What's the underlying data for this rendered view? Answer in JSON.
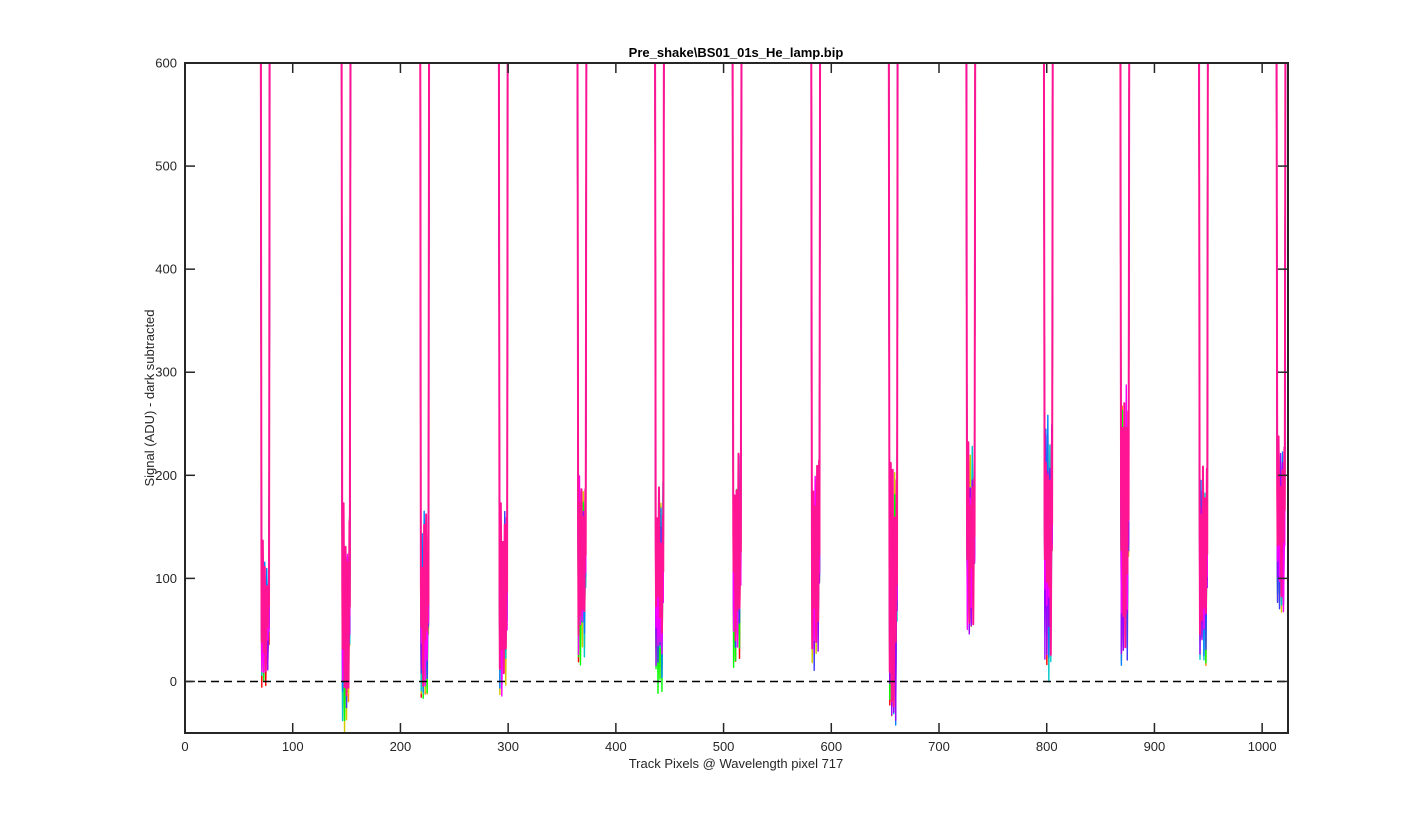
{
  "chart_data": {
    "type": "line",
    "title": "Pre_shake\\BS01_01s_He_lamp.bip",
    "xlabel": "Track Pixels @ Wavelength pixel 717",
    "ylabel": "Signal (ADU) - dark subtracted",
    "xlim": [
      0,
      1024
    ],
    "ylim": [
      -50,
      600
    ],
    "xticks": [
      0,
      100,
      200,
      300,
      400,
      500,
      600,
      700,
      800,
      900,
      1000
    ],
    "yticks": [
      0,
      100,
      200,
      300,
      400,
      500,
      600
    ],
    "grid": false,
    "legend": "none",
    "reference_line": {
      "y": 0,
      "style": "dashed",
      "color": "#000000"
    },
    "series_colors": [
      "#ff0000",
      "#ff8c00",
      "#d4c800",
      "#00ff00",
      "#00c8c8",
      "#0080ff",
      "#3c3cff",
      "#a000ff",
      "#ff00ff",
      "#ff1493"
    ],
    "track_pairs": [
      {
        "x1": 71,
        "x2": 78,
        "valley_min": -18,
        "valley_max": 145
      },
      {
        "x1": 146,
        "x2": 153,
        "valley_min": -50,
        "valley_max": 175
      },
      {
        "x1": 219,
        "x2": 226,
        "valley_min": -40,
        "valley_max": 170
      },
      {
        "x1": 292,
        "x2": 299,
        "valley_min": -22,
        "valley_max": 175
      },
      {
        "x1": 365,
        "x2": 372,
        "valley_min": 10,
        "valley_max": 215
      },
      {
        "x1": 437,
        "x2": 444,
        "valley_min": -22,
        "valley_max": 215
      },
      {
        "x1": 509,
        "x2": 516,
        "valley_min": 10,
        "valley_max": 222
      },
      {
        "x1": 582,
        "x2": 589,
        "valley_min": 8,
        "valley_max": 218
      },
      {
        "x1": 654,
        "x2": 661,
        "valley_min": -47,
        "valley_max": 215
      },
      {
        "x1": 726,
        "x2": 733,
        "valley_min": 27,
        "valley_max": 235
      },
      {
        "x1": 798,
        "x2": 805,
        "valley_min": -5,
        "valley_max": 290
      },
      {
        "x1": 869,
        "x2": 876,
        "valley_min": 2,
        "valley_max": 293
      },
      {
        "x1": 942,
        "x2": 949,
        "valley_min": -5,
        "valley_max": 232
      },
      {
        "x1": 1014,
        "x2": 1021,
        "valley_min": 55,
        "valley_max": 258
      }
    ]
  }
}
